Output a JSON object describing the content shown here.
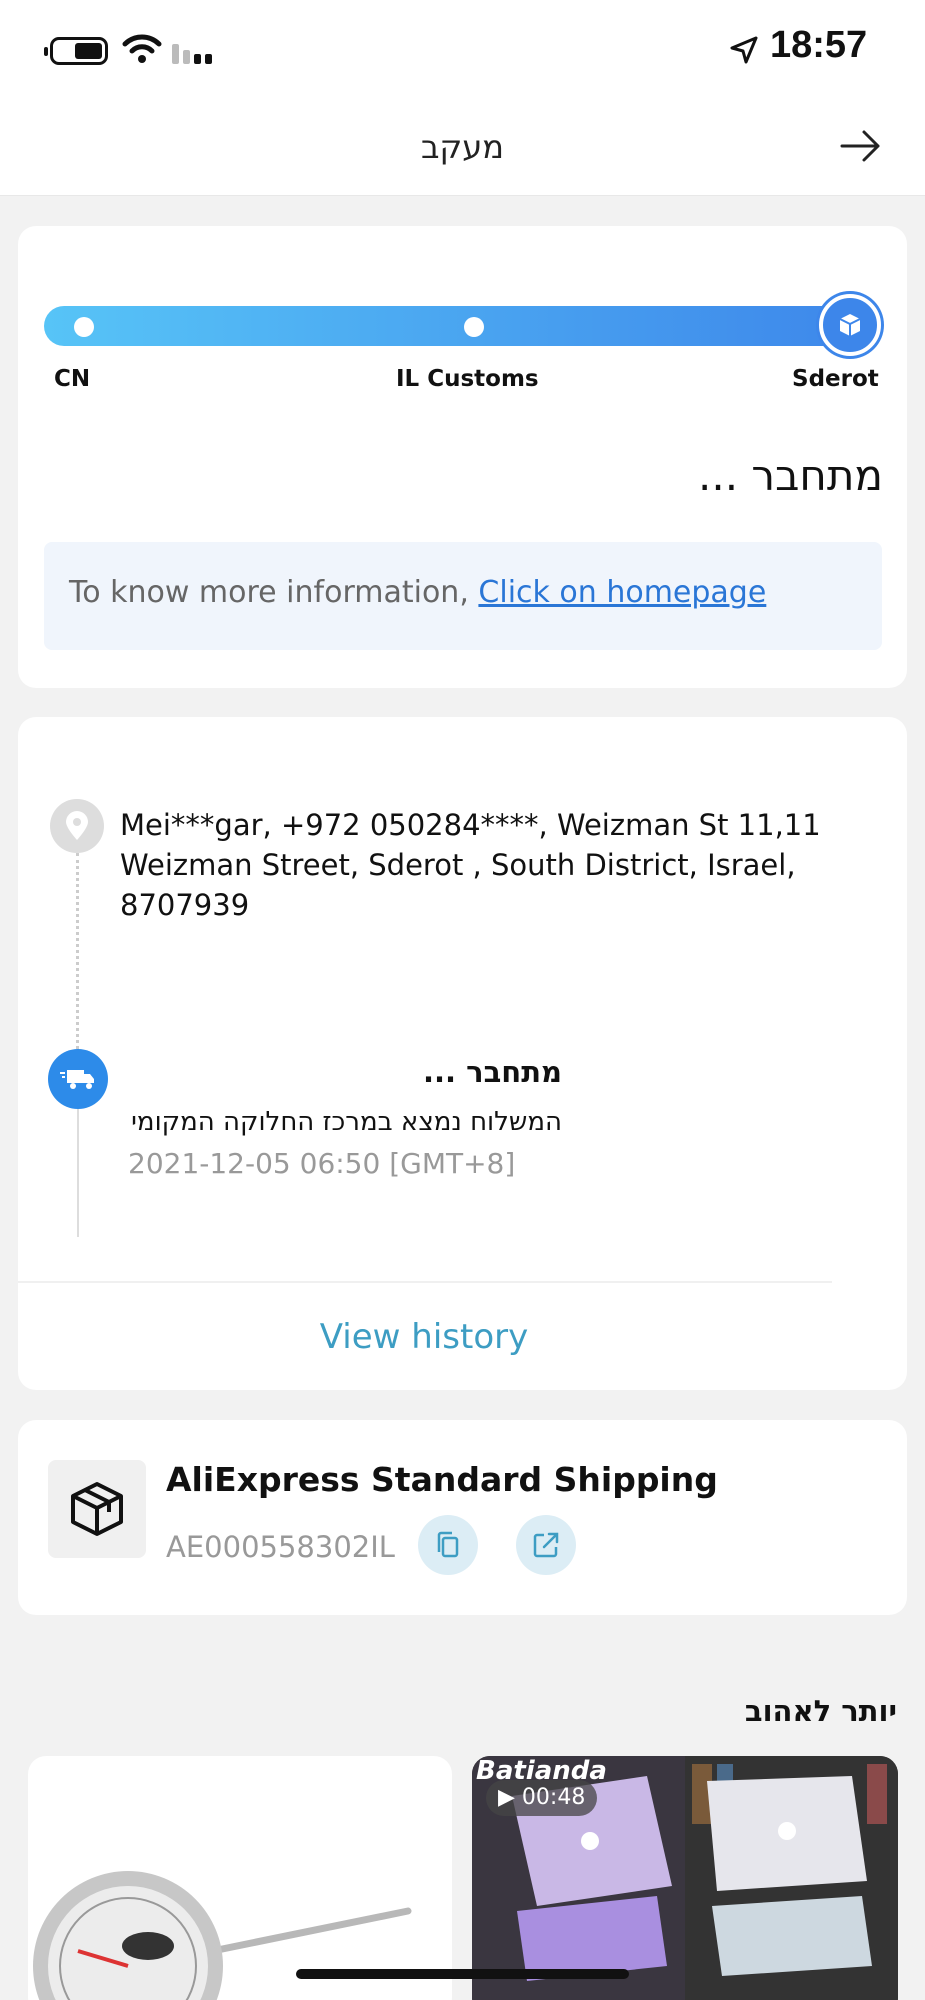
{
  "status_bar": {
    "time": "18:57"
  },
  "header": {
    "title": "מעקב"
  },
  "progress": {
    "stops": [
      "CN",
      "IL Customs",
      "Sderot"
    ],
    "status": "מתחבר ...",
    "info_text": "To know more information, ",
    "info_link": "Click on homepage"
  },
  "address": {
    "text": "Mei***gar,  +972 050284****,  Weizman St 11,11 Weizman Street,  Sderot ,  South District,  Israel,  8707939"
  },
  "event": {
    "title": "מתחבר ...",
    "description": "המשלוח נמצא במרכז החלוקה המקומי",
    "time": "2021-12-05 06:50 [GMT+8]"
  },
  "view_history_label": "View history",
  "shipping": {
    "name": "AliExpress Standard Shipping",
    "tracking_number": "AE000558302IL"
  },
  "recommendations": {
    "title": "יותר לאהוב",
    "video_brand": "Batianda",
    "video_duration": "▶ 00:48"
  },
  "colors": {
    "accent_blue": "#3d86ea",
    "progress_start": "#57c4f7",
    "link_teal": "#3d9dc3"
  }
}
